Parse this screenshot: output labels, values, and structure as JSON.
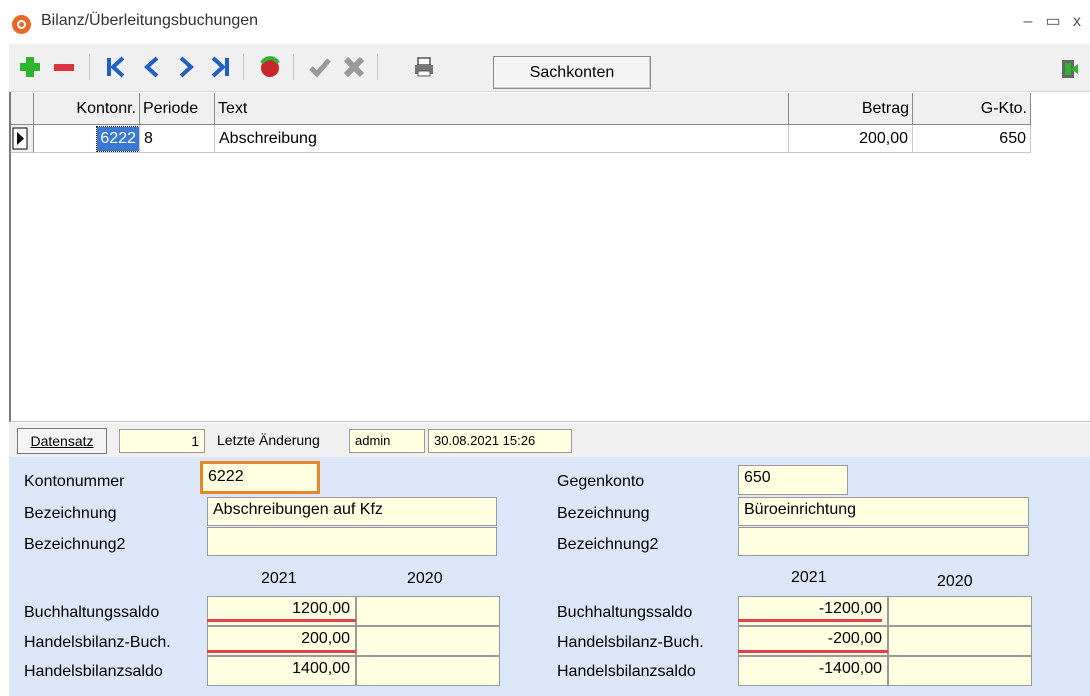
{
  "window": {
    "title": "Bilanz/Überleitungsbuchungen",
    "minimize": "–",
    "maximize": "▭",
    "close": "x"
  },
  "toolbar": {
    "sachkonten_label": "Sachkonten"
  },
  "grid": {
    "headers": {
      "kontonr": "Kontonr.",
      "periode": "Periode",
      "text": "Text",
      "betrag": "Betrag",
      "gkto": "G-Kto."
    },
    "rows": [
      {
        "kontonr": "6222",
        "periode": "8",
        "text": "Abschreibung",
        "betrag": "200,00",
        "gkto": "650"
      }
    ]
  },
  "status": {
    "datensatz_label": "Datensatz",
    "datensatz_value": "1",
    "letzte_label": "Letzte Änderung",
    "user": "admin",
    "timestamp": "30.08.2021 15:26"
  },
  "form": {
    "left": {
      "kontonummer_label": "Kontonummer",
      "kontonummer": "6222",
      "bezeichnung_label": "Bezeichnung",
      "bezeichnung": "Abschreibungen auf Kfz",
      "bezeichnung2_label": "Bezeichnung2",
      "bezeichnung2": "",
      "year1": "2021",
      "year2": "2020",
      "rows": [
        {
          "label": "Buchhaltungssaldo",
          "v1": "1200,00",
          "v2": ""
        },
        {
          "label": "Handelsbilanz-Buch.",
          "v1": "200,00",
          "v2": ""
        },
        {
          "label": "Handelsbilanzsaldo",
          "v1": "1400,00",
          "v2": ""
        }
      ]
    },
    "right": {
      "gegenkonto_label": "Gegenkonto",
      "gegenkonto": "650",
      "bezeichnung_label": "Bezeichnung",
      "bezeichnung": "Büroeinrichtung",
      "bezeichnung2_label": "Bezeichnung2",
      "bezeichnung2": "",
      "year1": "2021",
      "year2": "2020",
      "rows": [
        {
          "label": "Buchhaltungssaldo",
          "v1": "-1200,00",
          "v2": ""
        },
        {
          "label": "Handelsbilanz-Buch.",
          "v1": "-200,00",
          "v2": ""
        },
        {
          "label": "Handelsbilanzsaldo",
          "v1": "-1400,00",
          "v2": ""
        }
      ]
    }
  },
  "icons": [
    "app-icon",
    "add-icon",
    "delete-icon",
    "first-record-icon",
    "previous-icon",
    "next-icon",
    "last-record-icon",
    "refresh-icon",
    "confirm-icon",
    "cancel-icon",
    "print-icon",
    "exit-icon"
  ],
  "colors": {
    "field_bg": "#ffffe1",
    "form_bg": "#dbe7f8",
    "highlight": "#e8862a",
    "underline": "#e8414b",
    "selection": "#3a7ad6"
  }
}
